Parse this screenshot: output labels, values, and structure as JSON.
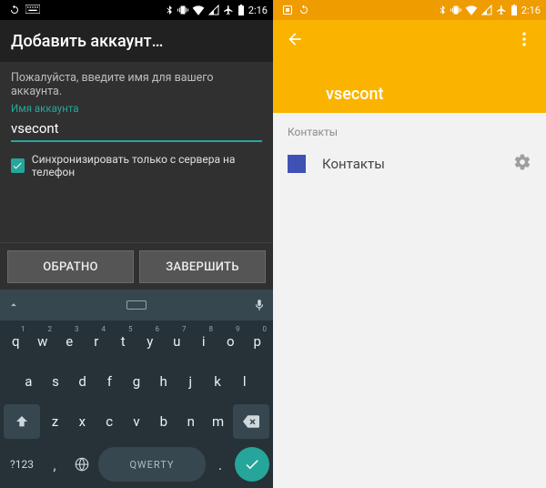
{
  "status": {
    "time": "2:16"
  },
  "left": {
    "title": "Добавить аккаунт…",
    "prompt": "Пожалуйста, введите имя для вашего аккаунта.",
    "field_label": "Имя аккаунта",
    "field_value": "vsecont",
    "checkbox_label": "Синхронизировать только с сервера на телефон",
    "buttons": {
      "back": "ОБРАТНО",
      "finish": "ЗАВЕРШИТЬ"
    },
    "keyboard": {
      "row1": [
        "q",
        "w",
        "e",
        "r",
        "t",
        "y",
        "u",
        "i",
        "o",
        "p"
      ],
      "row1_sup": [
        "1",
        "2",
        "3",
        "4",
        "5",
        "6",
        "7",
        "8",
        "9",
        "0"
      ],
      "row2": [
        "a",
        "s",
        "d",
        "f",
        "g",
        "h",
        "j",
        "k",
        "l"
      ],
      "row3": [
        "z",
        "x",
        "c",
        "v",
        "b",
        "n",
        "m"
      ],
      "symbols": "?123",
      "space_label": "QWERTY"
    }
  },
  "right": {
    "account_name": "vsecont",
    "section_header": "Контакты",
    "rows": [
      {
        "label": "Контакты"
      }
    ]
  }
}
